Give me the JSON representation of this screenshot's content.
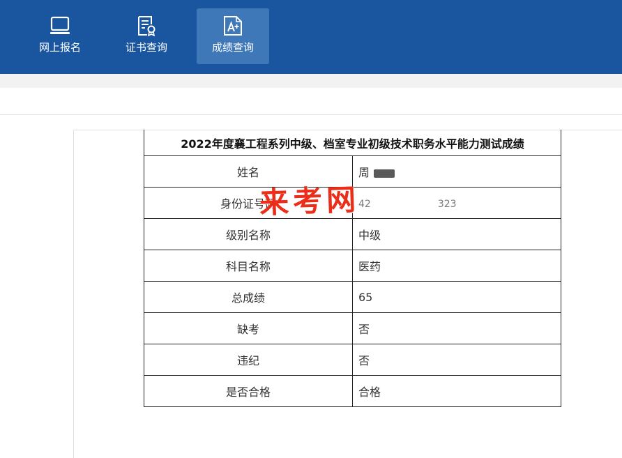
{
  "nav": {
    "items": [
      {
        "label": "网上报名",
        "icon": "laptop-icon"
      },
      {
        "label": "证书查询",
        "icon": "certificate-icon"
      },
      {
        "label": "成绩查询",
        "icon": "grade-document-icon",
        "active": true
      }
    ]
  },
  "result": {
    "title": "2022年度襄工程系列中级、档室专业初级技术职务水平能力测试成绩",
    "rows": [
      {
        "key": "姓名",
        "value": "周"
      },
      {
        "key": "身份证号码",
        "value_start": "42",
        "value_end": "323"
      },
      {
        "key": "级别名称",
        "value": "中级"
      },
      {
        "key": "科目名称",
        "value": "医药"
      },
      {
        "key": "总成绩",
        "value": "65"
      },
      {
        "key": "缺考",
        "value": "否"
      },
      {
        "key": "违纪",
        "value": "否"
      },
      {
        "key": "是否合格",
        "value": "合格"
      }
    ]
  },
  "watermark": "来考网",
  "colors": {
    "nav_bg": "#1a56a0",
    "nav_active": "#3f78b8",
    "watermark": "#ea2e1a"
  }
}
